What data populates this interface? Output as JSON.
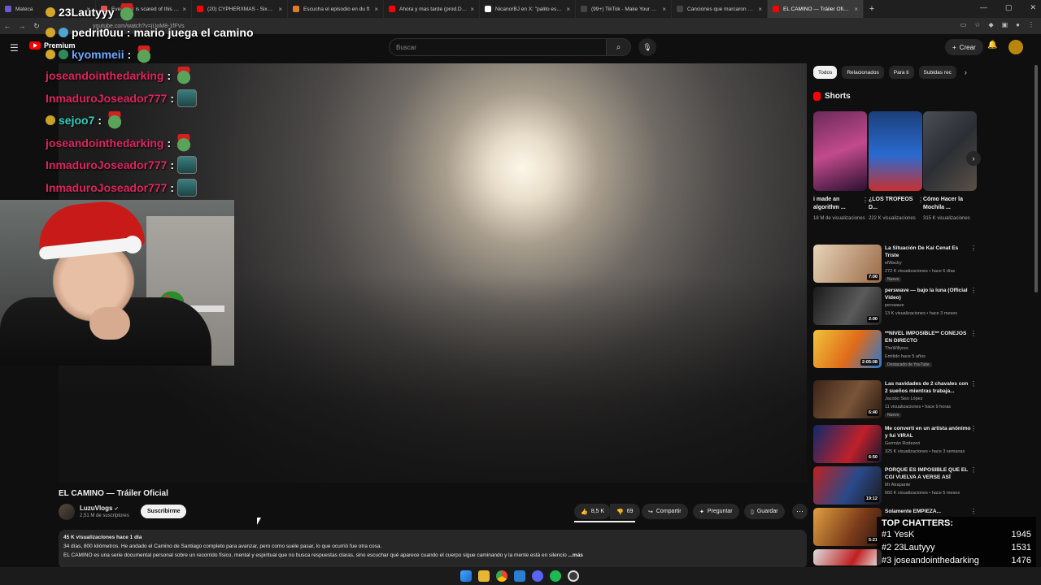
{
  "browser": {
    "tabs": [
      {
        "label": "Mateca",
        "color": "#6a5acd"
      },
      {
        "label": "Even fear is scared of this skate",
        "color": "#e35050"
      },
      {
        "label": "(20) CYPHERXMAS - SixUp, Jos",
        "color": "#ff0000"
      },
      {
        "label": "Escucha el episodio en du ft",
        "color": "#e07b2a"
      },
      {
        "label": "Ahora y mas tarde (prod.Dardo",
        "color": "#ff0000"
      },
      {
        "label": "NicanorBJ en X: \"palito es autis",
        "color": "#ffffff"
      },
      {
        "label": "(99+) TikTok - Make Your Day",
        "color": "#111111"
      },
      {
        "label": "Canciones que marcaron el 202",
        "color": "#111111"
      },
      {
        "label": "EL CAMINO — Tráiler Oficial",
        "color": "#ff0000"
      }
    ],
    "url": "youtube.com/watch?v=jUoM8-1fFVs"
  },
  "youtube": {
    "logo_text": "Premium",
    "search_placeholder": "Buscar",
    "create_label": "Crear"
  },
  "chat": [
    {
      "user": "23Lautyyy",
      "message": "",
      "color": "#ffffff",
      "emote": "frog"
    },
    {
      "user": "pedrit0uu",
      "message": "mario juega el camino",
      "color": "#ffffff",
      "emote": ""
    },
    {
      "user": "kyommeii",
      "message": "",
      "color": "#6fa8ff",
      "emote": "frog"
    },
    {
      "user": "joseandointhedarking",
      "message": "",
      "color": "#e0245e",
      "emote": "frog"
    },
    {
      "user": "InmaduroJoseador777",
      "message": "",
      "color": "#e0245e",
      "emote": "box"
    },
    {
      "user": "sejoo7",
      "message": "",
      "color": "#2ecfc0",
      "emote": "frog"
    },
    {
      "user": "joseandointhedarking",
      "message": "",
      "color": "#e0245e",
      "emote": "frog"
    },
    {
      "user": "InmaduroJoseador777",
      "message": "",
      "color": "#e0245e",
      "emote": "box"
    },
    {
      "user": "InmaduroJoseador777",
      "message": "",
      "color": "#e0245e",
      "emote": "box"
    }
  ],
  "video": {
    "title": "EL CAMINO — Tráiler Oficial",
    "channel": "LuzuVlogs",
    "subscribers": "2,51 M de suscriptores",
    "subscribe_label": "Suscribirme",
    "likes": "8,5 K",
    "dislikes": "69",
    "share_label": "Compartir",
    "ask_label": "Preguntar",
    "save_label": "Guardar",
    "description": {
      "stats": "45 K visualizaciones  hace 1 día",
      "line1": "34 días, 800 kilómetros. He andado el Camino de Santiago completo para avanzar, pero como suele pasar, lo que ocurrió fue otra cosa.",
      "line2": "EL CAMINO es una serie documental personal sobre un recorrido físico, mental y espiritual que no busca respuestas claras, sino escuchar qué aparece cuando el cuerpo sigue caminando y la mente está en silencio",
      "more": "...más"
    }
  },
  "chips": [
    "Todos",
    "Relacionados",
    "Para ti",
    "Subidas rec"
  ],
  "shorts": {
    "heading": "Shorts",
    "items": [
      {
        "title": "i made an algorithm ...",
        "views": "18 M de visualizaciones",
        "color": "#b04a86"
      },
      {
        "title": "¿LOS TROFEOS D...",
        "views": "222 K visualizaciones",
        "color": "#2a5fae"
      },
      {
        "title": "Cómo Hacer la Mochila ...",
        "views": "315 K visualizaciones",
        "color": "#3d4048"
      }
    ]
  },
  "recommendations": [
    {
      "title": "La Situación De Kai Cenat Es Triste",
      "channel": "elWacky",
      "meta": "272 K visualizaciones • hace 6 días",
      "badge": "Nuevo",
      "duration": "7:00",
      "color": "#c9a27e"
    },
    {
      "title": "perswave — bajo la luna (Official Video)",
      "channel": "perswave",
      "meta": "13 K visualizaciones • hace 3 meses",
      "badge": "",
      "duration": "2:00",
      "color": "#3a3a3a"
    },
    {
      "title": "**NIVEL IMPOSIBLE** CONEJOS EN DIRECTO",
      "channel": "TheWillyrex",
      "meta": "Emitido hace 5 años",
      "badge": "Destacado de YouTube",
      "duration": "2:05:08",
      "color": "#e5b52a"
    },
    {
      "title": "Las navidades de 2 chavales con 2 sueños mientras trabaja...",
      "channel": "Jacobo Siso López",
      "meta": "11 visualizaciones • hace 9 horas",
      "badge": "Nuevo",
      "duration": "6:40",
      "color": "#5b4030"
    },
    {
      "title": "Me convertí en un artista anónimo y fui VIRAL",
      "channel": "Germán Rodezeri",
      "meta": "325 K visualizaciones • hace 3 semanas",
      "badge": "",
      "duration": "6:50",
      "color": "#1f3d8a"
    },
    {
      "title": "PORQUE ES IMPOSIBLE QUE EL CGI VUELVA A VERSE ASÍ",
      "channel": "Mr Atrapante",
      "meta": "660 K visualizaciones • hace 5 meses",
      "badge": "",
      "duration": "19:12",
      "color": "#7a2a2a"
    },
    {
      "title": "Solamente EMPIEZA...",
      "channel": "",
      "meta": "",
      "badge": "",
      "duration": "5:21",
      "color": "#c08a3a"
    }
  ],
  "top_chatters": {
    "title": "TOP CHATTERS:",
    "rows": [
      {
        "rank": "#1",
        "name": "YesK",
        "count": "1945"
      },
      {
        "rank": "#2",
        "name": "23Lautyyy",
        "count": "1531"
      },
      {
        "rank": "#3",
        "name": "joseandointhedarking",
        "count": "1476"
      }
    ]
  },
  "accent_colors": {
    "youtube_red": "#ff0000",
    "background": "#0f0f0f",
    "surface": "#272727"
  }
}
